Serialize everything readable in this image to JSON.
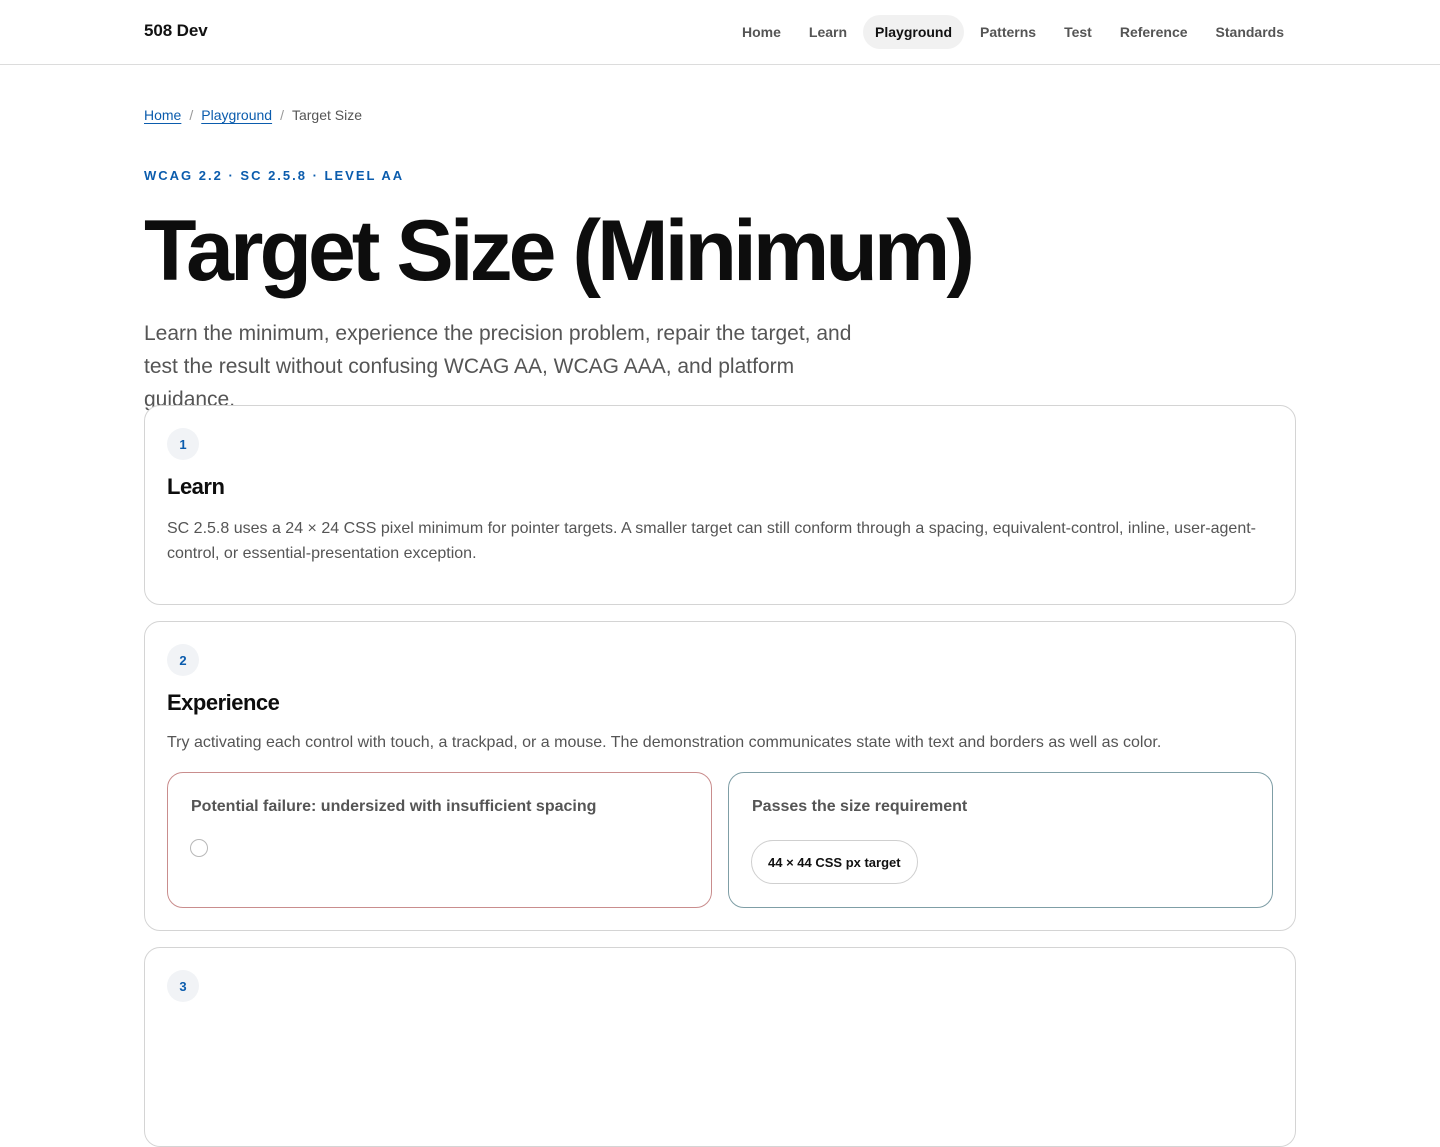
{
  "header": {
    "brand": "508 Dev",
    "nav": [
      {
        "label": "Home",
        "active": false
      },
      {
        "label": "Learn",
        "active": false
      },
      {
        "label": "Playground",
        "active": true
      },
      {
        "label": "Patterns",
        "active": false
      },
      {
        "label": "Test",
        "active": false
      },
      {
        "label": "Reference",
        "active": false
      },
      {
        "label": "Standards",
        "active": false
      }
    ]
  },
  "breadcrumb": {
    "home": "Home",
    "separator": "/",
    "playground": "Playground",
    "current": "Target Size"
  },
  "eyebrow": "WCAG 2.2 · SC 2.5.8 · LEVEL AA",
  "title": "Target Size (Minimum)",
  "lead": "Learn the minimum, experience the precision problem, repair the target, and test the result without confusing WCAG AA, WCAG AAA, and platform guidance.",
  "steps": [
    {
      "number": "1",
      "title": "Learn",
      "body": "SC 2.5.8 uses a 24 × 24 CSS pixel minimum for pointer targets. A smaller target can still conform through a spacing, equivalent-control, inline, user-agent-control, or essential-presentation exception."
    },
    {
      "number": "2",
      "title": "Experience",
      "body": "Try activating each control with touch, a trackpad, or a mouse. The demonstration communicates state with text and borders as well as color.",
      "demos": {
        "fail": {
          "title": "Potential failure: undersized with insufficient spacing"
        },
        "pass": {
          "title": "Passes the size requirement",
          "button_label": "44 × 44 CSS px target"
        }
      }
    },
    {
      "number": "3"
    }
  ],
  "colors": {
    "accent": "#0b5cad",
    "fail_border": "#c98d8d",
    "pass_border": "#7f9ea6"
  }
}
